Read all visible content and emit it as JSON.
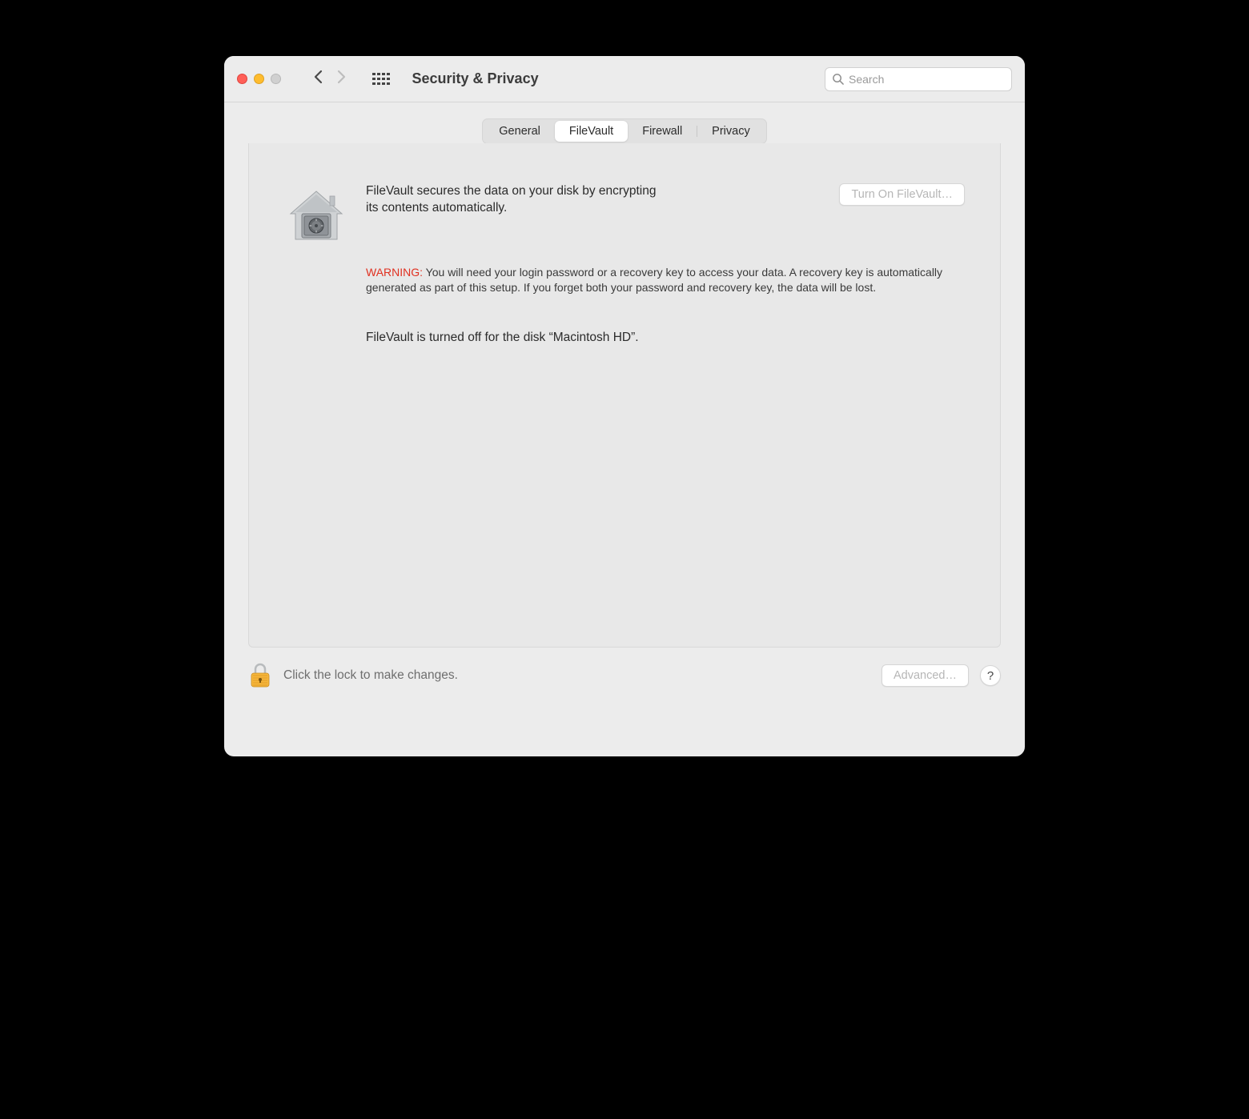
{
  "window": {
    "title": "Security & Privacy"
  },
  "search": {
    "placeholder": "Search",
    "value": ""
  },
  "tabs": [
    {
      "label": "General",
      "active": false
    },
    {
      "label": "FileVault",
      "active": true
    },
    {
      "label": "Firewall",
      "active": false
    },
    {
      "label": "Privacy",
      "active": false
    }
  ],
  "filevault": {
    "description": "FileVault secures the data on your disk by encrypting its contents automatically.",
    "turn_on_label": "Turn On FileVault…",
    "warning_label": "WARNING:",
    "warning_text": " You will need your login password or a recovery key to access your data. A recovery key is automatically generated as part of this setup. If you forget both your password and recovery key, the data will be lost.",
    "status": "FileVault is turned off for the disk “Macintosh HD”."
  },
  "footer": {
    "lock_text": "Click the lock to make changes.",
    "advanced_label": "Advanced…",
    "help_label": "?"
  }
}
